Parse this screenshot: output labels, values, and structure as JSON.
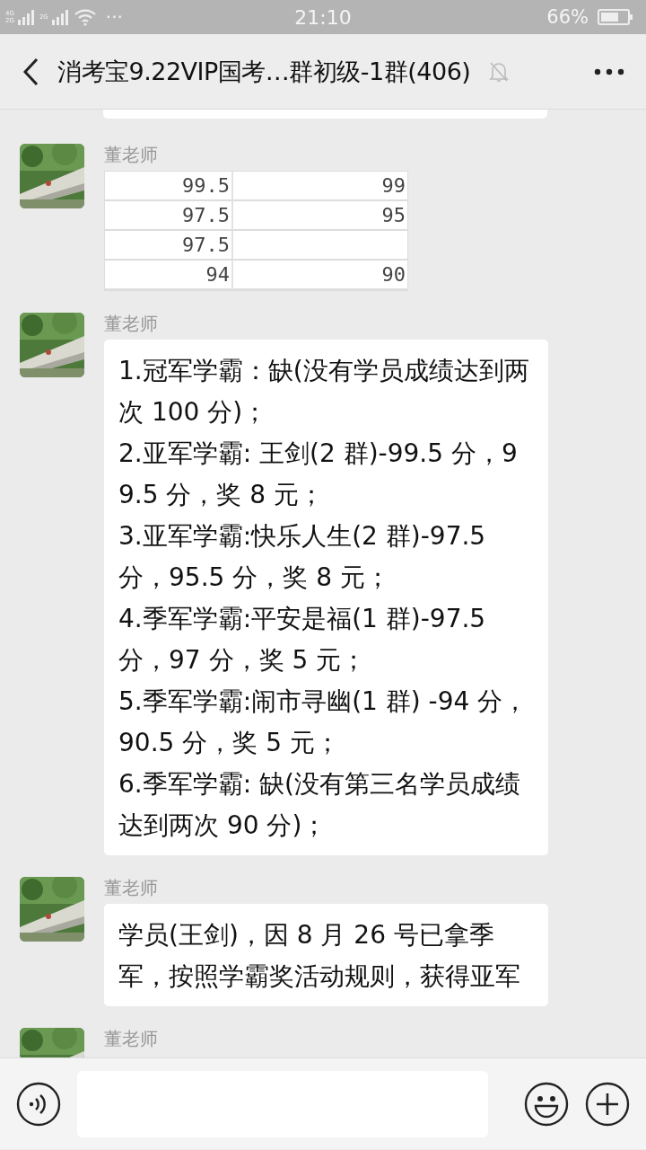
{
  "status_bar": {
    "network_labels": [
      "4G",
      "2G",
      "2G"
    ],
    "more": "···",
    "time": "21:10",
    "battery": "66%"
  },
  "header": {
    "title": "消考宝9.22VIP国考…群初级-1群(406)",
    "muted": true
  },
  "messages": [
    {
      "kind": "partial"
    },
    {
      "kind": "table",
      "sender": "董老师",
      "rows": [
        {
          "column_1": "99.5",
          "column_2": "99"
        },
        {
          "column_1": "97.5",
          "column_2": "95"
        },
        {
          "column_1": "97.5"
        },
        {
          "column_1": "94",
          "column_2": "90"
        }
      ]
    },
    {
      "kind": "text",
      "sender": "董老师",
      "text": "1.冠军学霸：缺(没有学员成绩达到两次 100 分)；\n2.亚军学霸: 王剑(2 群)-99.5 分，99.5 分，奖 8 元；\n3.亚军学霸:快乐人生(2 群)-97.5 分，95.5 分，奖 8 元；\n4.季军学霸:平安是福(1 群)-97.5 分，97 分，奖 5 元；\n5.季军学霸:闹市寻幽(1 群) -94 分，90.5 分，奖 5 元；\n6.季军学霸: 缺(没有第三名学员成绩达到两次 90 分)；"
    },
    {
      "kind": "text",
      "sender": "董老师",
      "text": "学员(王剑)，因 8 月 26 号已拿季军，按照学霸奖活动规则，获得亚军"
    },
    {
      "kind": "cut",
      "sender": "董老师"
    }
  ]
}
